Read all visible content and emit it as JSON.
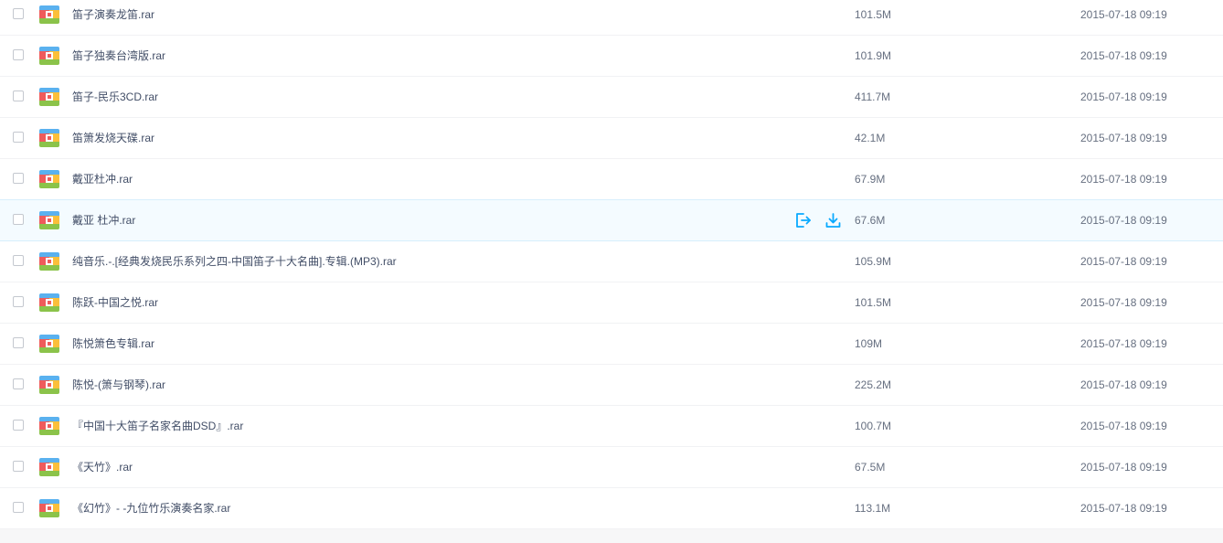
{
  "file_list": {
    "hover_row_index": 5,
    "actions": {
      "share_icon": "share-export-icon",
      "download_icon": "download-icon",
      "icon_color": "#09aaff"
    },
    "icon_colors": {
      "left": "#ef5b5b",
      "right": "#fbbf3a",
      "top": "#5ab1ef",
      "bottom": "#8bc34a",
      "clasp": "#ffffff"
    },
    "rows": [
      {
        "name": "笛子演奏龙笛.rar",
        "size": "101.5M",
        "date": "2015-07-18 09:19"
      },
      {
        "name": "笛子独奏台湾版.rar",
        "size": "101.9M",
        "date": "2015-07-18 09:19"
      },
      {
        "name": "笛子-民乐3CD.rar",
        "size": "411.7M",
        "date": "2015-07-18 09:19"
      },
      {
        "name": "笛箫发烧天碟.rar",
        "size": "42.1M",
        "date": "2015-07-18 09:19"
      },
      {
        "name": "戴亚杜冲.rar",
        "size": "67.9M",
        "date": "2015-07-18 09:19"
      },
      {
        "name": "戴亚 杜冲.rar",
        "size": "67.6M",
        "date": "2015-07-18 09:19"
      },
      {
        "name": "纯音乐.-.[经典发烧民乐系列之四-中国笛子十大名曲].专辑.(MP3).rar",
        "size": "105.9M",
        "date": "2015-07-18 09:19"
      },
      {
        "name": "陈跃-中国之悦.rar",
        "size": "101.5M",
        "date": "2015-07-18 09:19"
      },
      {
        "name": "陈悦箫色专辑.rar",
        "size": "109M",
        "date": "2015-07-18 09:19"
      },
      {
        "name": "陈悦-(箫与钢琴).rar",
        "size": "225.2M",
        "date": "2015-07-18 09:19"
      },
      {
        "name": "『中国十大笛子名家名曲DSD』.rar",
        "size": "100.7M",
        "date": "2015-07-18 09:19"
      },
      {
        "name": "《天竹》.rar",
        "size": "67.5M",
        "date": "2015-07-18 09:19"
      },
      {
        "name": "《幻竹》- -九位竹乐演奏名家.rar",
        "size": "113.1M",
        "date": "2015-07-18 09:19"
      }
    ]
  }
}
